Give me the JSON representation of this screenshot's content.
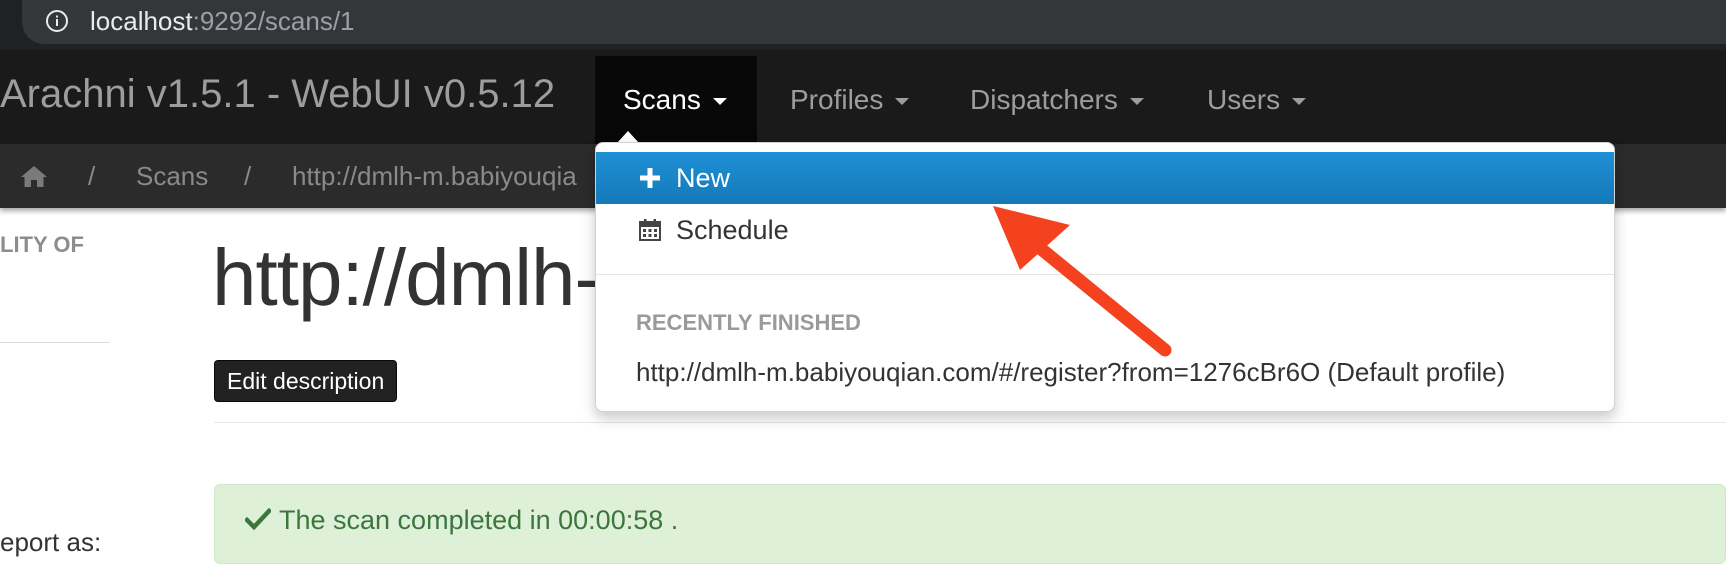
{
  "browser": {
    "url_host": "localhost",
    "url_rest": ":9292/scans/1"
  },
  "navbar": {
    "brand": "Arachni v1.5.1 - WebUI v0.5.12",
    "items": [
      {
        "label": "Scans",
        "active": true
      },
      {
        "label": "Profiles"
      },
      {
        "label": "Dispatchers"
      },
      {
        "label": "Users"
      }
    ]
  },
  "breadcrumb": {
    "separator": "/",
    "items": [
      "Scans",
      "http://dmlh-m.babiyouqia"
    ]
  },
  "sidebar": {
    "heading_fragment": "LITY OF",
    "text_fragment": "eport as:"
  },
  "main": {
    "title_fragment": "http://dmlh-",
    "edit_button": "Edit description",
    "alert_text": "The scan completed in 00:00:58 ."
  },
  "dropdown": {
    "items": [
      {
        "label": "New",
        "icon": "plus-icon",
        "highlighted": true
      },
      {
        "label": "Schedule",
        "icon": "calendar-icon"
      }
    ],
    "section_header": "RECENTLY FINISHED",
    "recent_scan": "http://dmlh-m.babiyouqian.com/#/register?from=1276cBr6O (Default profile)"
  },
  "colors": {
    "navbar_bg": "#1a1a1a",
    "highlight": "#1a84c7",
    "alert_bg": "#dff0d8",
    "alert_text": "#3c763d",
    "annotation_arrow": "#f4411e"
  }
}
